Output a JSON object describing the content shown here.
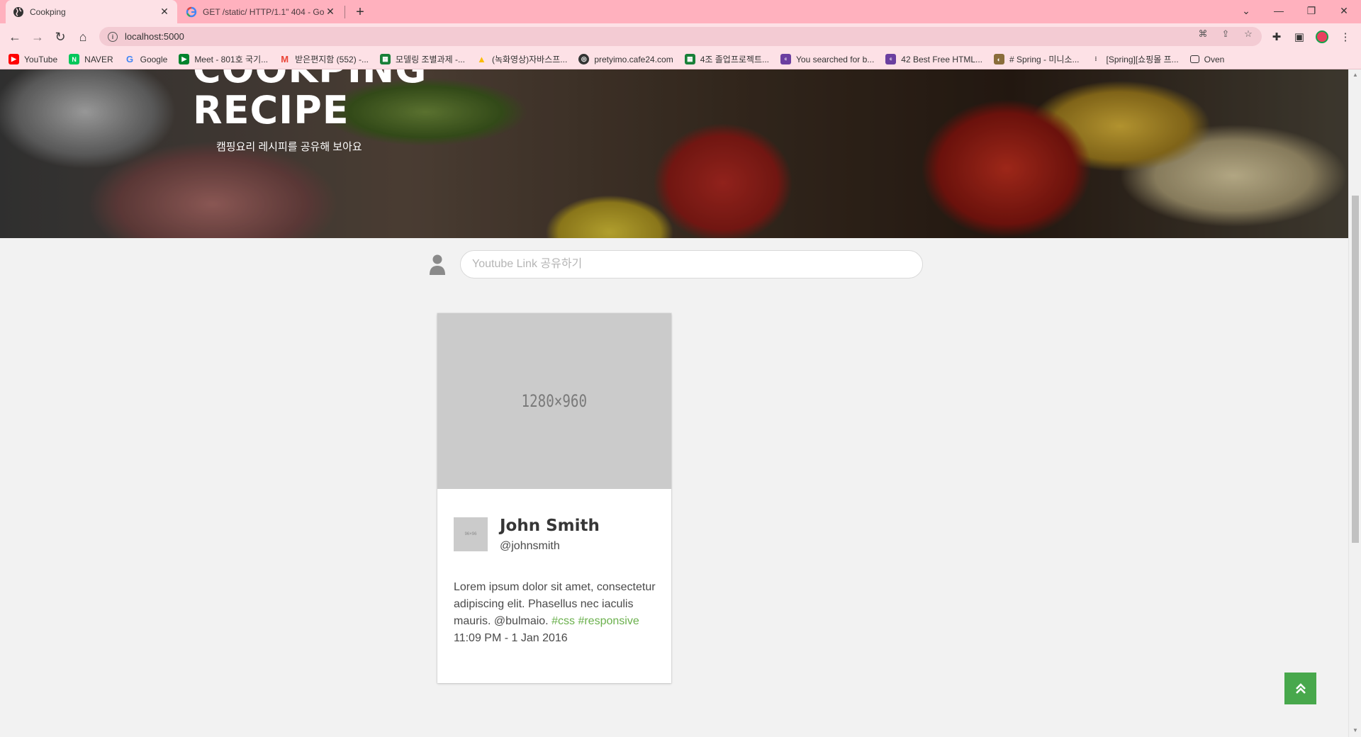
{
  "browser": {
    "tabs": [
      {
        "title": "Cookping",
        "active": true
      },
      {
        "title": "GET /static/ HTTP/1.1\" 404 - Go",
        "active": false
      }
    ],
    "url": "localhost:5000",
    "bookmarks": [
      {
        "label": "YouTube",
        "icon": "youtube-icon",
        "color": "#ff0000"
      },
      {
        "label": "NAVER",
        "icon": "naver-icon",
        "color": "#03c75a"
      },
      {
        "label": "Google",
        "icon": "google-icon",
        "color": "#4285f4"
      },
      {
        "label": "Meet - 801호 국기...",
        "icon": "meet-icon",
        "color": "#00832d"
      },
      {
        "label": "받은편지함 (552) -...",
        "icon": "gmail-icon",
        "color": "#ea4335"
      },
      {
        "label": "모델링 조별과제 -...",
        "icon": "sheets-icon",
        "color": "#188038"
      },
      {
        "label": "(녹화영상)자바스프...",
        "icon": "drive-icon",
        "color": "#fbbc04"
      },
      {
        "label": "pretyimo.cafe24.com",
        "icon": "globe-icon",
        "color": "#333333"
      },
      {
        "label": "4조 졸업프로젝트...",
        "icon": "sheets-icon",
        "color": "#188038"
      },
      {
        "label": "You searched for b...",
        "icon": "colorlib-icon",
        "color": "#6b3fa0"
      },
      {
        "label": "42 Best Free HTML...",
        "icon": "colorlib-icon",
        "color": "#6b3fa0"
      },
      {
        "label": "# Spring - 미니소...",
        "icon": "image-icon",
        "color": "#8a6d3b"
      },
      {
        "label": "[Spring][쇼핑몰 프...",
        "icon": "velog-icon",
        "color": "#333333"
      },
      {
        "label": "Oven",
        "icon": "oven-icon",
        "color": "#333333"
      }
    ]
  },
  "hero": {
    "title_top": "COOKPING",
    "title": "RECIPE",
    "subtitle": "캠핑요리 레시피를 공유해 보아요"
  },
  "composer": {
    "placeholder": "Youtube Link 공유하기"
  },
  "card": {
    "image_label": "1280×960",
    "thumb_label": "96×96",
    "name": "John Smith",
    "handle": "@johnsmith",
    "body": "Lorem ipsum dolor sit amet, consectetur adipiscing elit. Phasellus nec iaculis mauris. @bulmaio.",
    "tags": [
      "#css",
      "#responsive"
    ],
    "timestamp": "11:09 PM - 1 Jan 2016"
  },
  "colors": {
    "tabstrip": "#ffb1be",
    "toolbar": "#fde1e6",
    "accent_green": "#48a84c",
    "tag_green": "#6ab04c"
  }
}
